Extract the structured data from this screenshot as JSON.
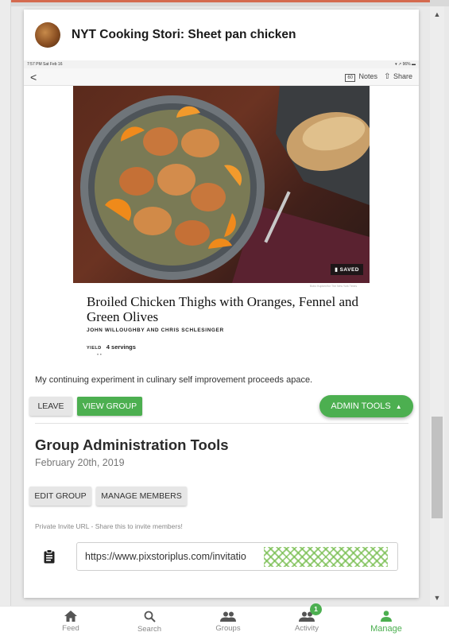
{
  "story": {
    "title": "NYT Cooking Stori: Sheet pan chicken"
  },
  "embedded": {
    "status_time": "7:57 PM  Sat Feb 16",
    "status_right": "▾ ↗ 96% ▬",
    "back": "<",
    "notes_count": "60",
    "notes_label": "Notes",
    "share_label": "Share",
    "saved_label": "SAVED",
    "credit": "Bobo Kupken/for The New York Times",
    "recipe_title": "Broiled Chicken Thighs with Oranges, Fennel and Green Olives",
    "recipe_authors": "JOHN WILLOUGHBY AND CHRIS SCHLESINGER",
    "yield_label": "YIELD",
    "yield_value": "4 servings",
    "yield_more": "• •"
  },
  "caption": "My continuing experiment in culinary self improvement proceeds apace.",
  "actions": {
    "leave": "LEAVE",
    "view_group": "VIEW GROUP",
    "admin_tools": "ADMIN TOOLS"
  },
  "admin": {
    "title": "Group Administration Tools",
    "date": "February 20th, 2019",
    "edit_group": "EDIT GROUP",
    "manage_members": "MANAGE MEMBERS",
    "invite_label": "Private Invite URL - Share this to invite members!",
    "invite_url": "https://www.pixstoriplus.com/invitatio"
  },
  "nav": {
    "feed": "Feed",
    "search": "Search",
    "groups": "Groups",
    "activity": "Activity",
    "activity_badge": "1",
    "manage": "Manage"
  },
  "colors": {
    "accent_green": "#4caf50",
    "frame_accent": "#d46a4f"
  },
  "icons": {
    "clipboard": "clipboard-icon",
    "feed": "home-icon",
    "search": "search-icon",
    "groups": "groups-icon",
    "activity": "activity-icon",
    "manage": "person-icon"
  }
}
